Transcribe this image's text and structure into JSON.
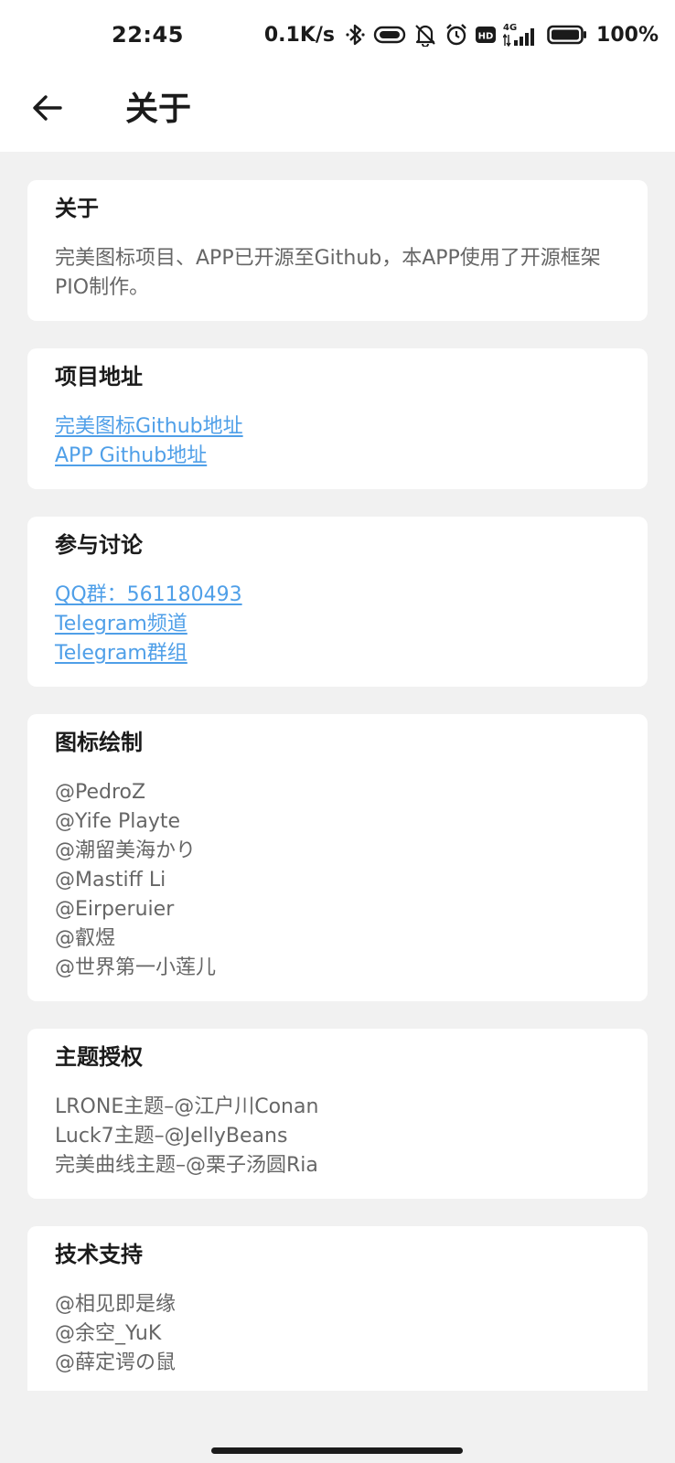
{
  "status_bar": {
    "time": "22:45",
    "speed": "0.1K/s",
    "network": "4G",
    "battery": "100%",
    "icons": [
      "bluetooth-icon",
      "vibrate-icon",
      "mute-icon",
      "alarm-icon",
      "hd-icon",
      "signal-icon",
      "battery-icon"
    ]
  },
  "app_bar": {
    "back_icon": "arrow-left-icon",
    "title": "关于"
  },
  "cards": {
    "about": {
      "title": "关于",
      "body": "完美图标项目、APP已开源至Github，本APP使用了开源框架PIO制作。"
    },
    "project": {
      "title": "项目地址",
      "links": [
        "完美图标Github地址",
        "APP Github地址"
      ]
    },
    "discussion": {
      "title": "参与讨论",
      "links": [
        "QQ群：561180493",
        "Telegram频道",
        "Telegram群组"
      ]
    },
    "icon_drawing": {
      "title": "图标绘制",
      "names": [
        "@PedroZ",
        "@Yife Playte",
        "@潮留美海かり",
        "@Mastiff Li",
        "@Eirperuier",
        "@叡煜",
        "@世界第一小莲儿"
      ]
    },
    "theme_license": {
      "title": "主题授权",
      "lines": [
        "LRONE主题–@江户川Conan",
        "Luck7主题–@JellyBeans",
        "完美曲线主题–@栗子汤圆Ria"
      ]
    },
    "tech_support": {
      "title": "技术支持",
      "names": [
        "@相见即是缘",
        "@余空_YuK",
        "@薛定谔の鼠"
      ]
    }
  },
  "colors": {
    "background": "#f1f1f1",
    "card": "#ffffff",
    "link": "#4f9fe8",
    "body_text": "#666666",
    "title_text": "#1b1b1b"
  }
}
